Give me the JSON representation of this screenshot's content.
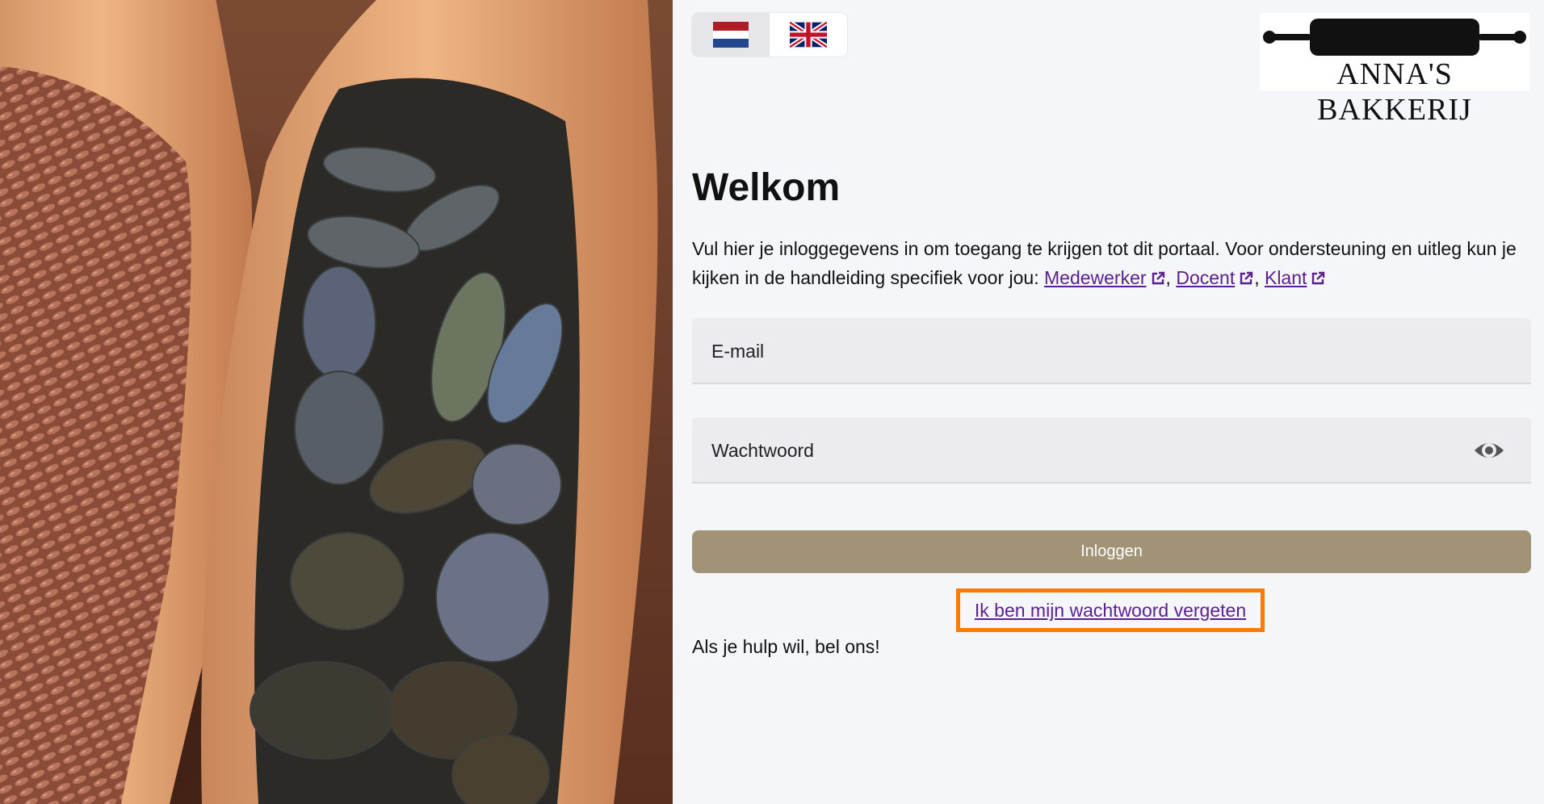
{
  "language_switcher": {
    "options": [
      {
        "code": "nl",
        "flag_icon": "flag-netherlands-icon",
        "active": true
      },
      {
        "code": "en",
        "flag_icon": "flag-united-kingdom-icon",
        "active": false
      }
    ]
  },
  "logo": {
    "text": "ANNA'S BAKKERIJ",
    "icon": "rolling-pin-icon"
  },
  "hero_image": {
    "icon": "seeds-in-scoops-photo"
  },
  "main": {
    "title": "Welkom",
    "intro_text": "Vul hier je inloggegevens in om toegang te krijgen tot dit portaal. Voor ondersteuning en uitleg kun je kijken in de handleiding specifiek voor jou: ",
    "links": [
      {
        "label": "Medewerker",
        "icon": "external-link-icon"
      },
      {
        "label": "Docent",
        "icon": "external-link-icon"
      },
      {
        "label": "Klant",
        "icon": "external-link-icon"
      }
    ],
    "separator": ", "
  },
  "form": {
    "email": {
      "placeholder": "E-mail",
      "value": ""
    },
    "password": {
      "placeholder": "Wachtwoord",
      "value": "",
      "toggle_icon": "eye-icon"
    },
    "submit_label": "Inloggen",
    "forgot_label": "Ik ben mijn wachtwoord vergeten"
  },
  "help_text": "Als je hulp wil, bel ons!",
  "colors": {
    "accent_button": "#a29377",
    "link": "#5b1f8f",
    "highlight_border": "#ff7a00",
    "background": "#f5f6fa"
  }
}
